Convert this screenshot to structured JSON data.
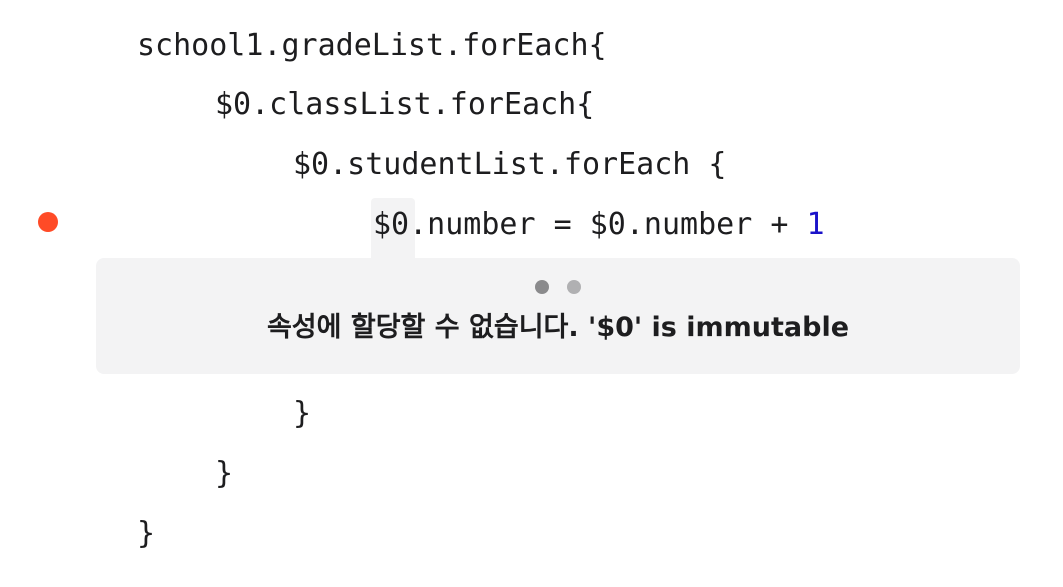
{
  "editor": {
    "lines": {
      "l1": "school1.gradeList.forEach{",
      "l2": "$0.classList.forEach{",
      "l3": "$0.studentList.forEach {",
      "l4_prefix": "$0.number = $0.number + ",
      "l4_literal": "1",
      "l5": "}",
      "l6": "}",
      "l7": "}"
    },
    "number_literal_color": "#1a12c9",
    "breakpoint_color": "#ff4b27"
  },
  "error_popover": {
    "message": "속성에 할당할 수 없습니다. '$0' is immutable",
    "page_count": 2,
    "active_page": 1
  }
}
